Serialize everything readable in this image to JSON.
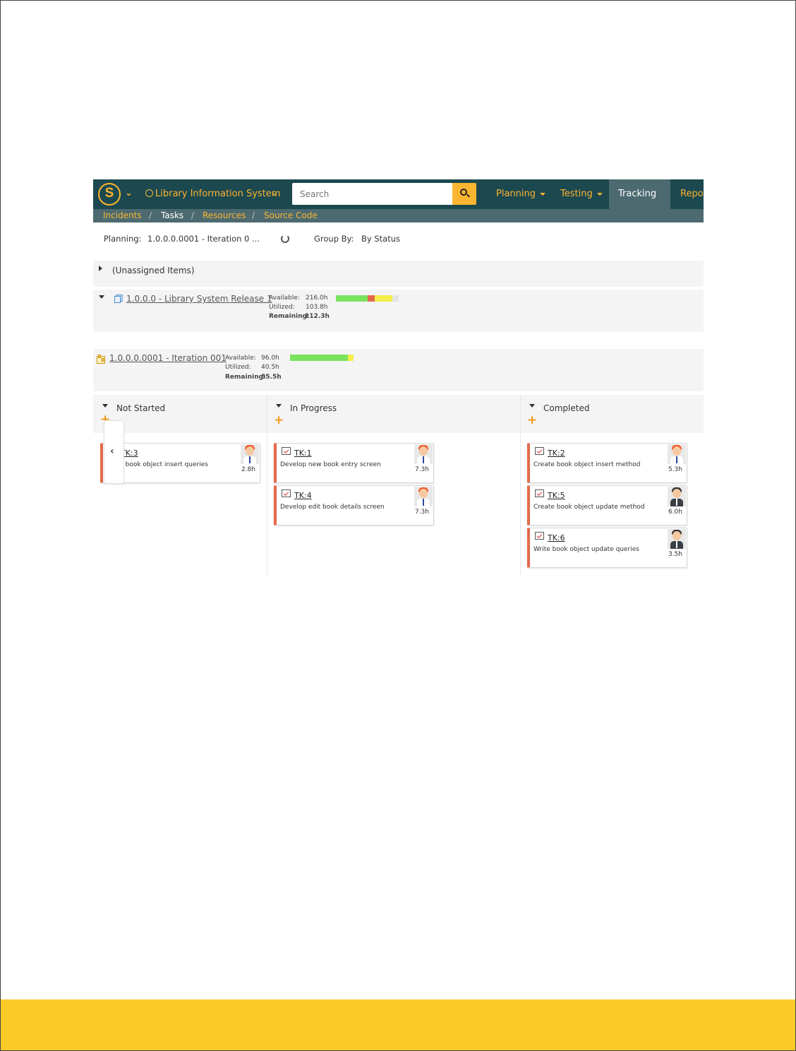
{
  "nav": {
    "project": "Library Information System",
    "search_placeholder": "Search",
    "items": [
      {
        "label": "Planning"
      },
      {
        "label": "Testing"
      },
      {
        "label": "Tracking"
      },
      {
        "label": "Repor"
      }
    ],
    "active": "Tracking"
  },
  "subnav": {
    "items": [
      "Incidents",
      "Tasks",
      "Resources",
      "Source Code"
    ],
    "separator": "/",
    "current": "Tasks"
  },
  "toolbar": {
    "planning_label": "Planning:",
    "planning_value": "1.0.0.0.0001 - Iteration 0 ...",
    "group_label": "Group By:",
    "group_value": "By Status"
  },
  "unassigned": {
    "label": "(Unassigned Items)"
  },
  "release": {
    "name": "1.0.0.0 - Library System Release 1",
    "available_label": "Available:",
    "available": "216.0h",
    "utilized_label": "Utilized:",
    "utilized": "103.8h",
    "remaining_label": "Remaining:",
    "remaining": "112.3h",
    "bar": {
      "completed_pct": 50,
      "late_pct": 12,
      "in_progress_pct": 28
    }
  },
  "iteration": {
    "name": "1.0.0.0.0001 - Iteration 001",
    "available_label": "Available:",
    "available": "96.0h",
    "utilized_label": "Utilized:",
    "utilized": "40.5h",
    "remaining_label": "Remaining:",
    "remaining": "55.5h",
    "bar": {
      "completed_pct": 91,
      "in_progress_pct": 9
    }
  },
  "columns": [
    {
      "title": "Not Started",
      "cards": [
        {
          "id": "TK:3",
          "name": "Write book object insert queries",
          "hours": "2.8h",
          "hair": "#f05a28"
        }
      ]
    },
    {
      "title": "In Progress",
      "cards": [
        {
          "id": "TK:1",
          "name": "Develop new book entry screen",
          "hours": "7.3h",
          "hair": "#f05a28"
        },
        {
          "id": "TK:4",
          "name": "Develop edit book details screen",
          "hours": "7.3h",
          "hair": "#f05a28"
        }
      ]
    },
    {
      "title": "Completed",
      "cards": [
        {
          "id": "TK:2",
          "name": "Create book object insert method",
          "hours": "5.3h",
          "hair": "#f05a28"
        },
        {
          "id": "TK:5",
          "name": "Create book object update method",
          "hours": "6.0h",
          "hair": "#333333"
        },
        {
          "id": "TK:6",
          "name": "Write book object update queries",
          "hours": "3.5h",
          "hair": "#333333"
        }
      ]
    }
  ],
  "colors": {
    "nav_bg": "#1c4850",
    "accent": "#fbb530",
    "footer": "#fbca27",
    "card_border": "#e5694d",
    "bar_green": "#79e35e",
    "bar_red": "#e5694d",
    "bar_yellow": "#f3ed4a"
  }
}
